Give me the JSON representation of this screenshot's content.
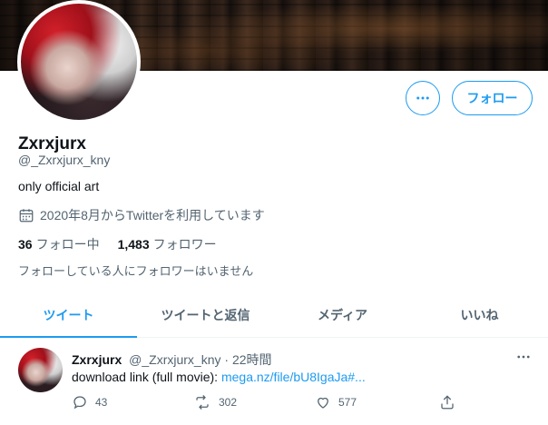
{
  "profile": {
    "display_name": "Zxrxjurx",
    "handle": "@_Zxrxjurx_kny",
    "bio": "only official art",
    "joined": "2020年8月からTwitterを利用しています",
    "following_count": "36",
    "following_label": "フォロー中",
    "followers_count": "1,483",
    "followers_label": "フォロワー",
    "followed_by_note": "フォローしている人にフォロワーはいません",
    "follow_button": "フォロー"
  },
  "tabs": [
    {
      "label": "ツイート",
      "active": true
    },
    {
      "label": "ツイートと返信",
      "active": false
    },
    {
      "label": "メディア",
      "active": false
    },
    {
      "label": "いいね",
      "active": false
    }
  ],
  "tweet": {
    "name": "Zxrxjurx",
    "handle": "@_Zxrxjurx_kny",
    "separator": "·",
    "time": "22時間",
    "text_prefix": "download link (full movie): ",
    "link_text": "mega.nz/file/bU8IgaJa#...",
    "replies": "43",
    "retweets": "302",
    "likes": "577"
  },
  "icons": {
    "more": "more-horizontal-icon",
    "calendar": "calendar-icon",
    "reply": "reply-icon",
    "retweet": "retweet-icon",
    "like": "heart-icon",
    "share": "share-icon"
  },
  "colors": {
    "accent": "#1d9bf0",
    "text": "#0f1419",
    "muted": "#536471"
  }
}
